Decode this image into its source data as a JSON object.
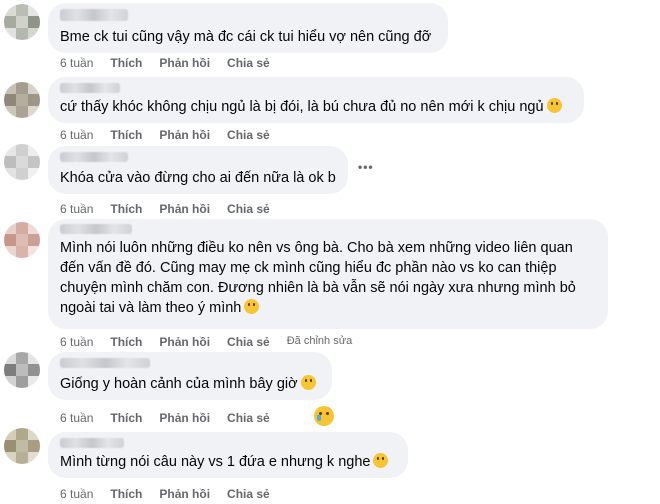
{
  "comments": [
    {
      "text": "Bme ck tui cũng vậy mà đc cái ck tui hiểu vợ nên cũng đỡ",
      "time": "6 tuần",
      "like": "Thích",
      "reply": "Phản hồi",
      "share": "Chia sẻ"
    },
    {
      "text": "cứ thấy khóc không chịu ngủ là bị đói, là bú chưa đủ no nên mới k chịu ngủ",
      "time": "6 tuần",
      "like": "Thích",
      "reply": "Phản hồi",
      "share": "Chia sẻ",
      "emoji": "grinning-sweat-emoji"
    },
    {
      "text": "Khóa cửa vào đừng cho ai đến nữa là ok b",
      "time": "6 tuần",
      "like": "Thích",
      "reply": "Phản hồi",
      "share": "Chia sẻ",
      "more": "•••"
    },
    {
      "text": "Mình nói luôn những điều ko nên vs ông bà. Cho bà xem những video liên quan đến vấn đề đó. Cũng may mẹ ck mình cũng hiểu đc phần nào vs ko can thiệp chuyện mình chăm con. Đương nhiên là bà vẫn sẽ nói ngày xưa nhưng mình bỏ ngoài tai và làm theo ý mình",
      "time": "6 tuần",
      "like": "Thích",
      "reply": "Phản hồi",
      "share": "Chia sẻ",
      "edited": "Đã chỉnh sửa",
      "emoji": "smile-emoji"
    },
    {
      "text": "Giống y hoàn cảnh của mình bây giờ",
      "time": "6 tuần",
      "like": "Thích",
      "reply": "Phản hồi",
      "share": "Chia sẻ",
      "emoji": "laughing-tears-emoji",
      "reaction": "sad-reaction-icon"
    },
    {
      "text": "Mình từng nói câu này vs 1 đứa e nhưng k nghe",
      "time": "6 tuần",
      "like": "Thích",
      "reply": "Phản hồi",
      "share": "Chia sẻ",
      "emoji": "rofl-emoji"
    }
  ],
  "colors": {
    "bubble": "#f0f2f5",
    "meta": "#65676b",
    "emoji": "#f7c531"
  }
}
